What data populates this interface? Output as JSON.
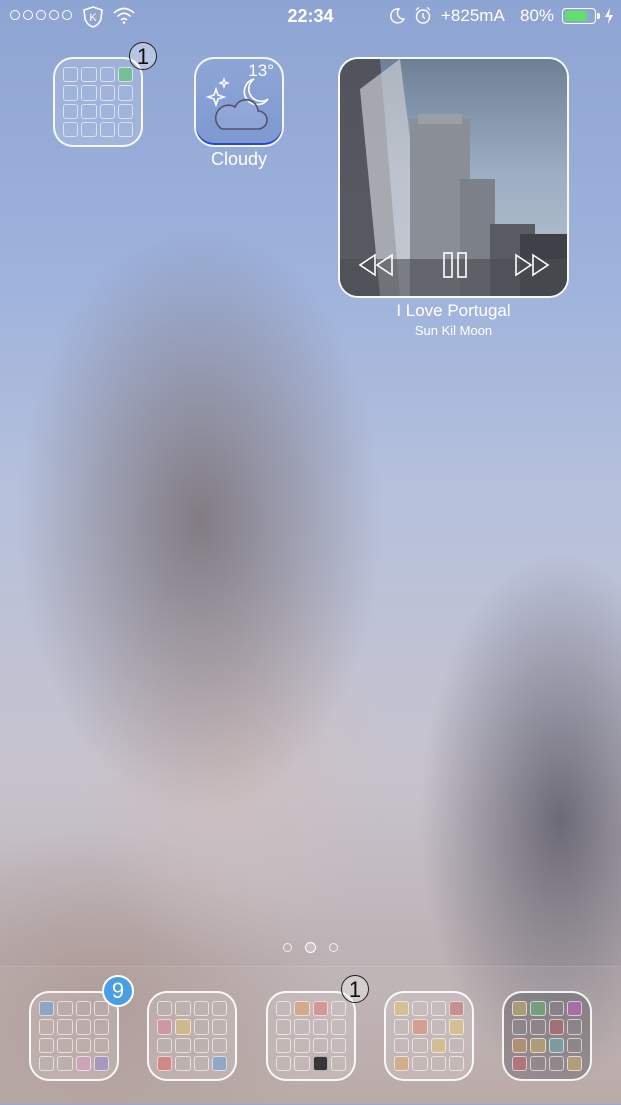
{
  "status_bar": {
    "time": "22:34",
    "power": "+825mA",
    "battery_percent": "80%",
    "battery_level": 0.8,
    "icons": [
      "signal-dots-icon",
      "shield-k-icon",
      "wifi-icon",
      "moon-icon",
      "alarm-icon",
      "battery-icon",
      "charging-bolt-icon"
    ]
  },
  "home": {
    "folder_top": {
      "badge": "1"
    },
    "weather": {
      "temperature": "13°",
      "label": "Cloudy"
    },
    "music": {
      "title": "I Love Portugal",
      "artist": "Sun Kil Moon"
    }
  },
  "page_indicator": {
    "count": 3,
    "active": 1
  },
  "dock": {
    "folders": [
      {
        "badge": "9",
        "badge_style": "blue"
      },
      {
        "badge": ""
      },
      {
        "badge": "1",
        "badge_style": "outline"
      },
      {
        "badge": ""
      },
      {
        "badge": ""
      }
    ]
  },
  "colors": {
    "badge_blue": "#4a9ee4",
    "battery_green": "#5fe06a",
    "weather_border": "#2a44d8"
  }
}
